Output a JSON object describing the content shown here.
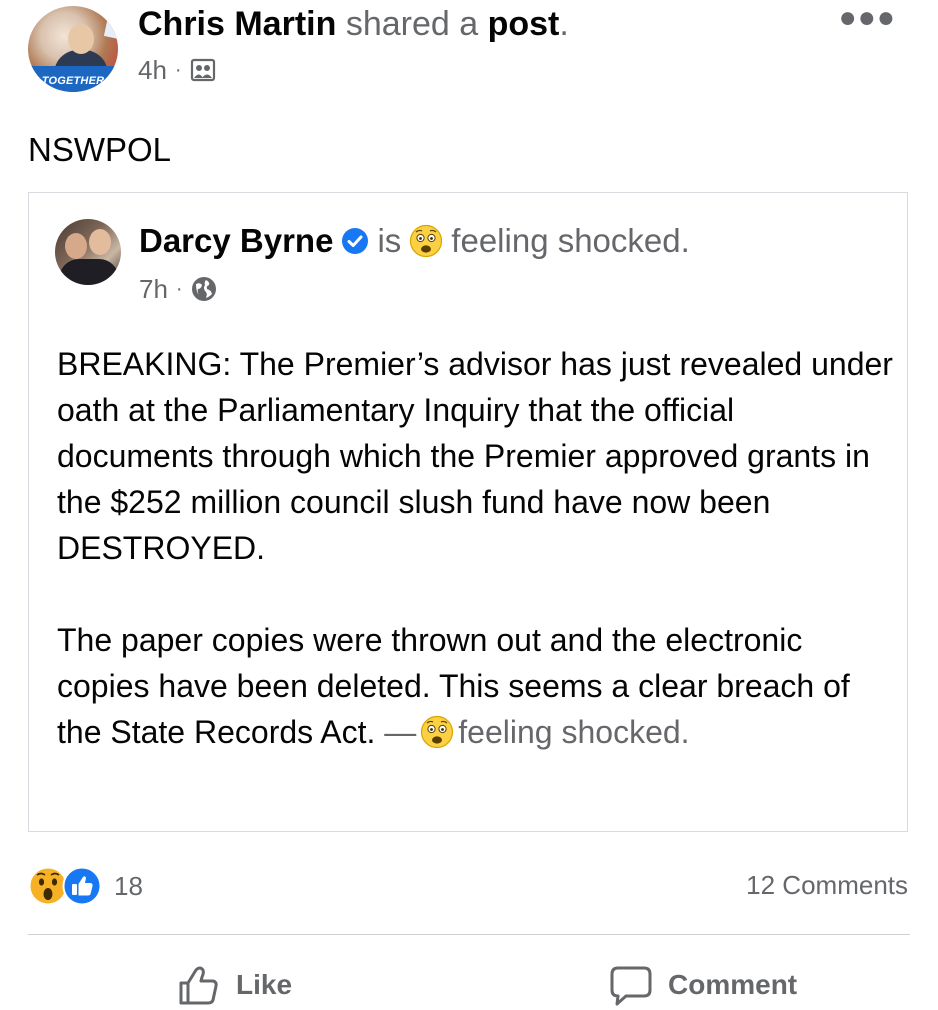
{
  "post": {
    "author": "Chris Martin",
    "action": "shared a",
    "object": "post",
    "punct": ".",
    "time": "4h",
    "separator": "·",
    "caption": "NSWPOL",
    "avatar_banner": "TOGETHER",
    "more_icon": "more-horizontal-icon",
    "audience_icon": "friends-icon"
  },
  "shared": {
    "author": "Darcy Byrne",
    "verb": "is",
    "feeling": "feeling shocked.",
    "time": "7h",
    "separator": "·",
    "audience_icon": "globe-icon",
    "paragraph1": "BREAKING: The Premier’s advisor has just revealed under oath at the Parliamentary Inquiry that the official documents through which the Premier approved grants in the $252 million council slush fund have now been DESTROYED.",
    "paragraph2": "The paper copies were thrown out and the electronic copies have been deleted. This seems a clear breach of the State Records Act.",
    "dash": "—",
    "feeling_tail": "feeling shocked."
  },
  "reactions": {
    "count": "18",
    "comments": "12 Comments",
    "icons": [
      "wow-icon",
      "like-icon"
    ]
  },
  "actions": {
    "like": "Like",
    "comment": "Comment"
  },
  "colors": {
    "text": "#050505",
    "muted": "#65676b",
    "facebook_blue": "#1877f2",
    "wow_yellow": "#f7b125",
    "divider": "#ced0d4"
  }
}
